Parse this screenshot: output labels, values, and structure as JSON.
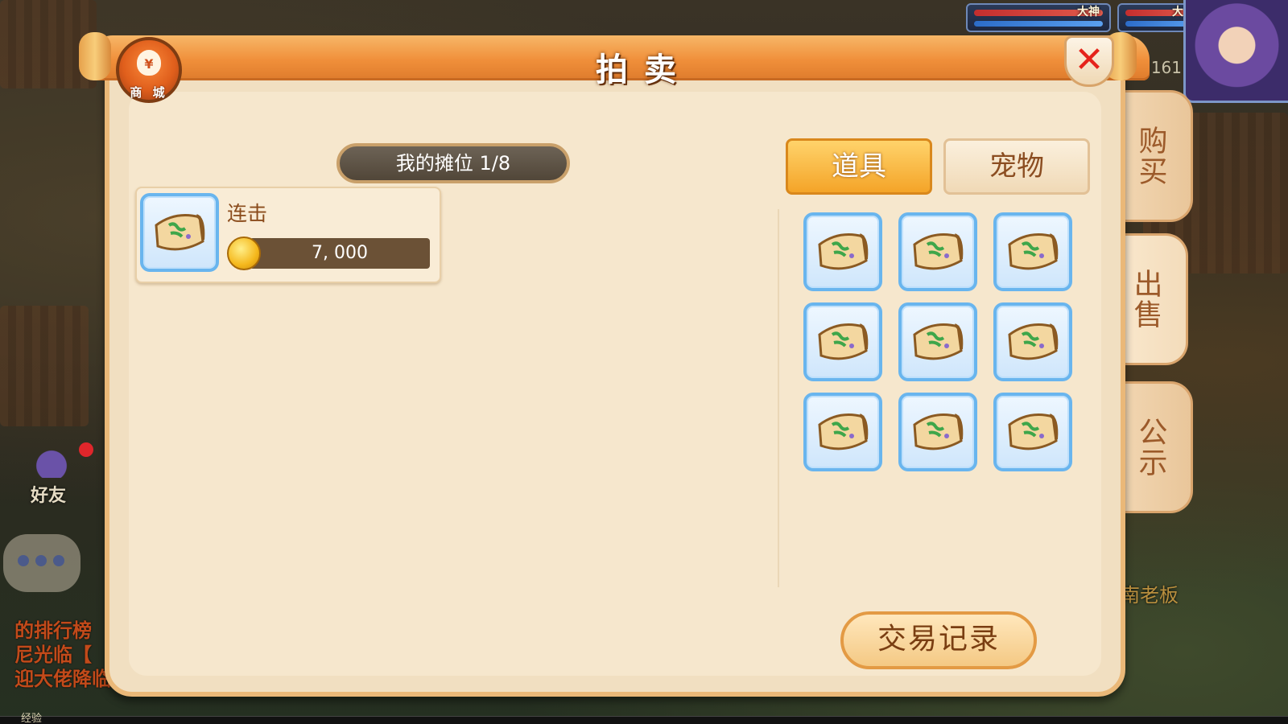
{
  "hud": {
    "player1_name": "大神",
    "player2_name": "大神",
    "level_text": "161"
  },
  "left_side": {
    "chat_line1": "的排行榜",
    "chat_line2": "尼光临【",
    "chat_line3": "迎大佬降临",
    "friend_label": "好友",
    "exp_label": "经验"
  },
  "right_side": {
    "boss_text": "南老板"
  },
  "mall": {
    "label": "商 城",
    "symbol": "¥"
  },
  "panel": {
    "title": "拍卖",
    "close_symbol": "✕"
  },
  "side_tabs": [
    {
      "label": "购买"
    },
    {
      "label": "出售"
    },
    {
      "label": "公示"
    }
  ],
  "stall": {
    "header": "我的摊位 1/8",
    "item": {
      "name": "连击",
      "price": "7, 000"
    }
  },
  "category_tabs": {
    "items": "道具",
    "pets": "宠物"
  },
  "inventory": {
    "slots": [
      "skill-scroll",
      "skill-scroll",
      "skill-scroll",
      "skill-scroll",
      "skill-scroll",
      "skill-scroll",
      "skill-scroll",
      "skill-scroll",
      "skill-scroll"
    ]
  },
  "buttons": {
    "trade_record": "交易记录"
  },
  "colors": {
    "panel": "#f1dfc1",
    "title_bar": "#f08f3a",
    "active_tab": "#f4a428",
    "slot_border": "#69b5ee",
    "close": "#e5231b"
  }
}
